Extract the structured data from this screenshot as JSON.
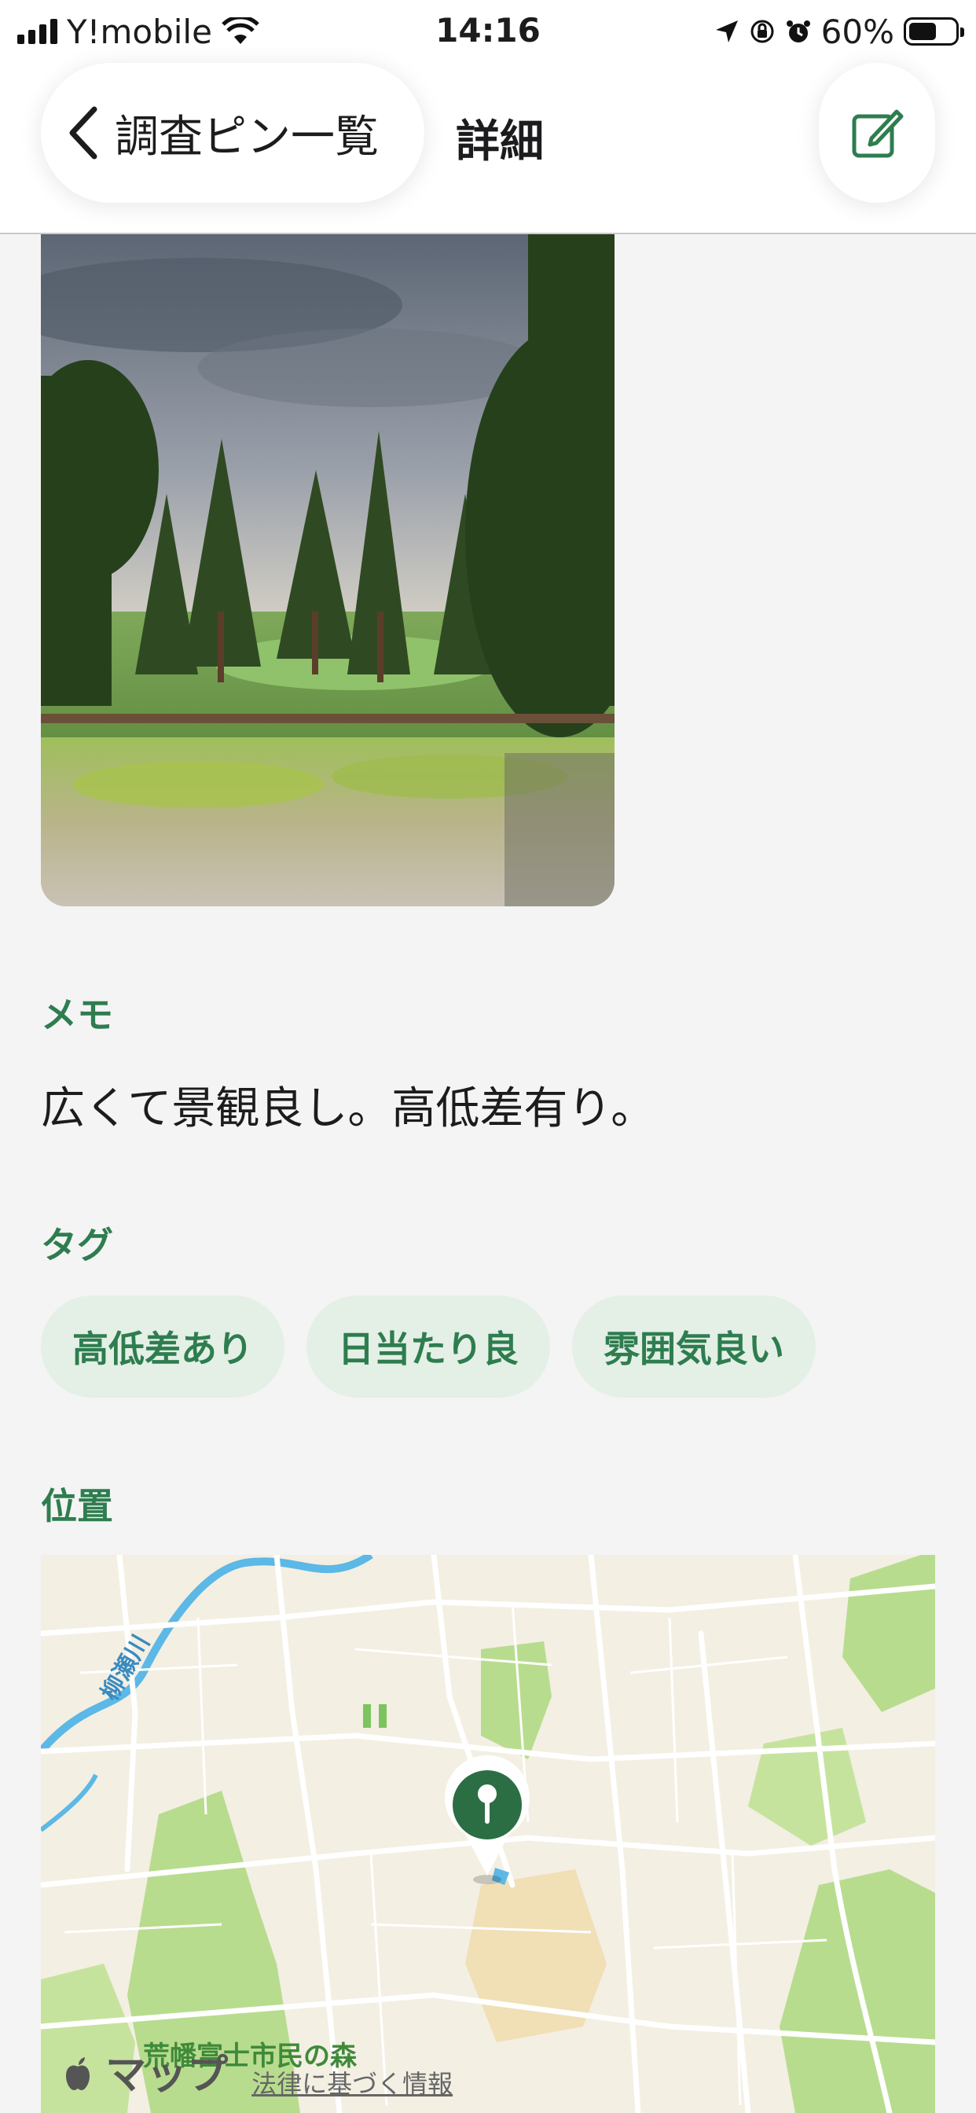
{
  "status_bar": {
    "carrier": "Y!mobile",
    "time": "14:16",
    "battery_percent": "60%",
    "battery_level": 0.6,
    "icons": [
      "signal-icon",
      "wifi-icon",
      "location-arrow-icon",
      "rotation-lock-icon",
      "alarm-icon",
      "battery-icon"
    ]
  },
  "nav": {
    "back_label": "調査ピン一覧",
    "title": "詳細",
    "edit_icon": "edit-icon"
  },
  "memo": {
    "label": "メモ",
    "text": "広くて景観良し。高低差有り。"
  },
  "tags": {
    "label": "タグ",
    "items": [
      "高低差あり",
      "日当たり良",
      "雰囲気良い"
    ]
  },
  "location": {
    "label": "位置",
    "map": {
      "river_label": "柳瀬川",
      "park_label": "荒幡富士市民の森",
      "brand": "マップ",
      "legal_link": "法律に基づく情報"
    }
  },
  "colors": {
    "accent": "#2e7d4f",
    "tag_background": "#e4efe6",
    "background": "#f4f4f4"
  }
}
